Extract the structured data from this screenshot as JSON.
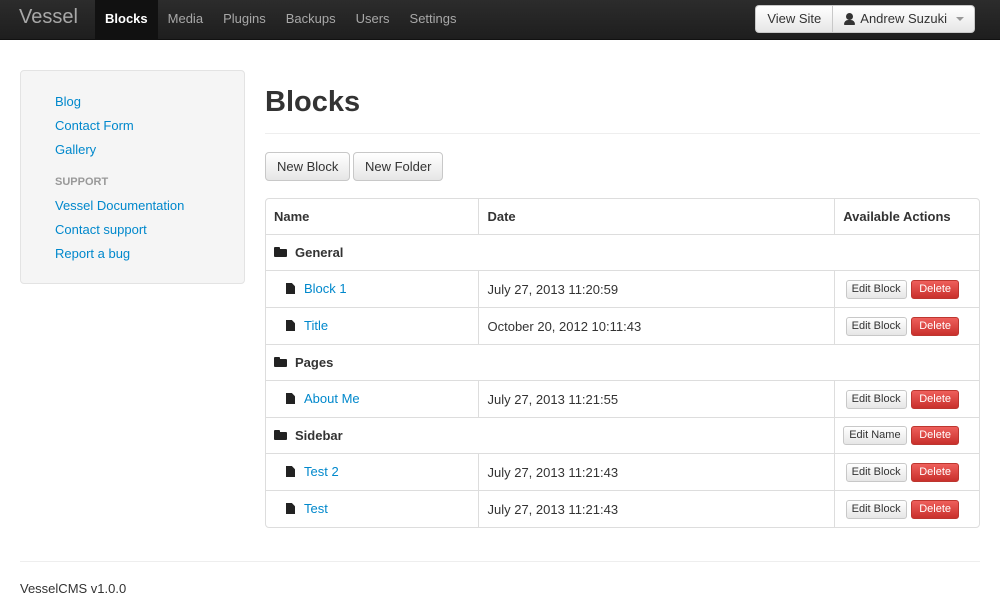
{
  "app": {
    "brand": "Vessel"
  },
  "nav": {
    "items": [
      {
        "label": "Blocks",
        "active": true
      },
      {
        "label": "Media"
      },
      {
        "label": "Plugins"
      },
      {
        "label": "Backups"
      },
      {
        "label": "Users"
      },
      {
        "label": "Settings"
      }
    ],
    "view_site": "View Site",
    "user": "Andrew Suzuki"
  },
  "sidebar": {
    "links": [
      "Blog",
      "Contact Form",
      "Gallery"
    ],
    "support_header": "SUPPORT",
    "support_links": [
      "Vessel Documentation",
      "Contact support",
      "Report a bug"
    ]
  },
  "main": {
    "title": "Blocks",
    "new_block": "New Block",
    "new_folder": "New Folder",
    "table": {
      "headers": [
        "Name",
        "Date",
        "Available Actions"
      ],
      "edit_block": "Edit Block",
      "edit_name": "Edit Name",
      "delete": "Delete",
      "rows": [
        {
          "type": "folder",
          "name": "General"
        },
        {
          "type": "block",
          "name": "Block 1",
          "date": "July 27, 2013 11:20:59"
        },
        {
          "type": "block",
          "name": "Title",
          "date": "October 20, 2012 10:11:43"
        },
        {
          "type": "folder",
          "name": "Pages"
        },
        {
          "type": "block",
          "name": "About Me",
          "date": "July 27, 2013 11:21:55"
        },
        {
          "type": "folder",
          "name": "Sidebar",
          "actions": true
        },
        {
          "type": "block",
          "name": "Test 2",
          "date": "July 27, 2013 11:21:43"
        },
        {
          "type": "block",
          "name": "Test",
          "date": "July 27, 2013 11:21:43"
        }
      ]
    }
  },
  "footer": {
    "text": "VesselCMS v1.0.0"
  },
  "colors": {
    "link": "#0088cc",
    "danger": "#da4f49",
    "navbar": "#222222"
  }
}
